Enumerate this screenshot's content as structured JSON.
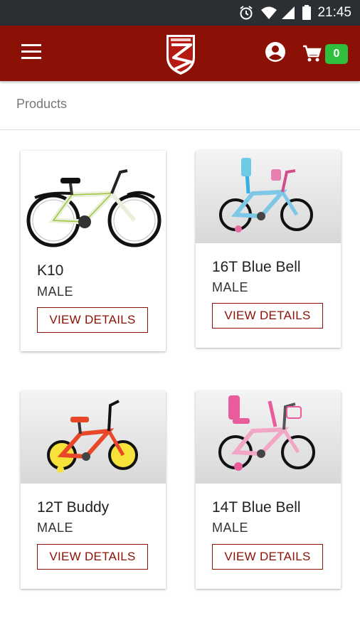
{
  "status": {
    "time": "21:45"
  },
  "header": {
    "cart_count": "0"
  },
  "breadcrumb": "Products",
  "products": [
    {
      "name": "K10",
      "gender": "MALE",
      "button": "VIEW DETAILS",
      "image": "mountain-bike-white-green"
    },
    {
      "name": "16T Blue Bell",
      "gender": "MALE",
      "button": "VIEW DETAILS",
      "image": "kids-bike-blue-pink"
    },
    {
      "name": "12T Buddy",
      "gender": "MALE",
      "button": "VIEW DETAILS",
      "image": "kids-bike-red-yellow"
    },
    {
      "name": "14T Blue Bell",
      "gender": "MALE",
      "button": "VIEW DETAILS",
      "image": "kids-bike-pink"
    }
  ],
  "colors": {
    "appbar": "#8b1005",
    "badge": "#2fbf3c",
    "statusbar": "#2b2f33"
  }
}
